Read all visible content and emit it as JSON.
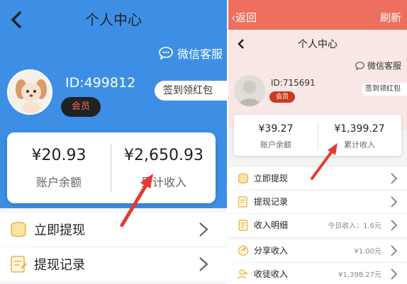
{
  "left": {
    "title": "个人中心",
    "customer_service": "微信客服",
    "user_id": "ID:499812",
    "member_badge": "会员",
    "sign_in": "签到领红包",
    "balance": {
      "value": "¥20.93",
      "label": "账户余额"
    },
    "total_income": {
      "value": "¥2,650.93",
      "label": "累计收入"
    },
    "menu": [
      {
        "label": "立即提现",
        "icon": "coins-icon"
      },
      {
        "label": "提现记录",
        "icon": "record-icon"
      }
    ]
  },
  "right": {
    "back": "返回",
    "refresh": "刷新",
    "title": "个人中心",
    "customer_service": "微信客服",
    "user_id": "ID:715691",
    "member_badge": "会员",
    "sign_in": "签到领红包",
    "balance": {
      "value": "¥39.27",
      "label": "账户余额"
    },
    "total_income": {
      "value": "¥1,399.27",
      "label": "累计收入"
    },
    "menu": [
      {
        "label": "立即提现",
        "value": "",
        "icon": "coins-icon"
      },
      {
        "label": "提现记录",
        "value": "",
        "icon": "record-icon"
      },
      {
        "label": "收入明细",
        "value": "今日收入：1.6元",
        "icon": "detail-icon"
      },
      {
        "label": "分享收入",
        "value": "¥1.00元",
        "icon": "share-icon"
      },
      {
        "label": "收徒收入",
        "value": "¥1,398.27元",
        "icon": "apprentice-icon"
      }
    ]
  },
  "colors": {
    "blue_header": "#3d8fe6",
    "orange_topbar": "#ee6f5e",
    "arrow": "#e8382c"
  }
}
